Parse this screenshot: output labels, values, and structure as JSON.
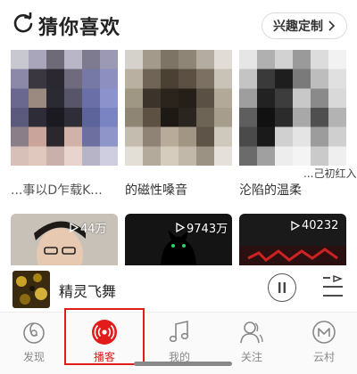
{
  "header": {
    "title": "猜你喜欢",
    "interest_button": "兴趣定制"
  },
  "recommendations": [
    {
      "caption": "...事以D乍载K...",
      "subtitle": ""
    },
    {
      "caption": "的磁性嗓音",
      "subtitle": ""
    },
    {
      "caption": "沦陷的温柔",
      "subtitle": "...己初红入"
    }
  ],
  "cards": [
    {
      "play_count": "44万"
    },
    {
      "play_count": "9743万"
    },
    {
      "play_count": "40232"
    }
  ],
  "mini_player": {
    "title": "精灵飞舞"
  },
  "tabs": [
    {
      "label": "发现",
      "icon": "discover-icon",
      "active": false
    },
    {
      "label": "播客",
      "icon": "podcast-icon",
      "active": true
    },
    {
      "label": "我的",
      "icon": "music-note-icon",
      "active": false
    },
    {
      "label": "关注",
      "icon": "follow-icon",
      "active": false
    },
    {
      "label": "云村",
      "icon": "cloud-village-icon",
      "active": false
    }
  ],
  "colors": {
    "accent": "#e21b1b",
    "tab_inactive": "#888888",
    "highlight": "#e21b1b"
  }
}
